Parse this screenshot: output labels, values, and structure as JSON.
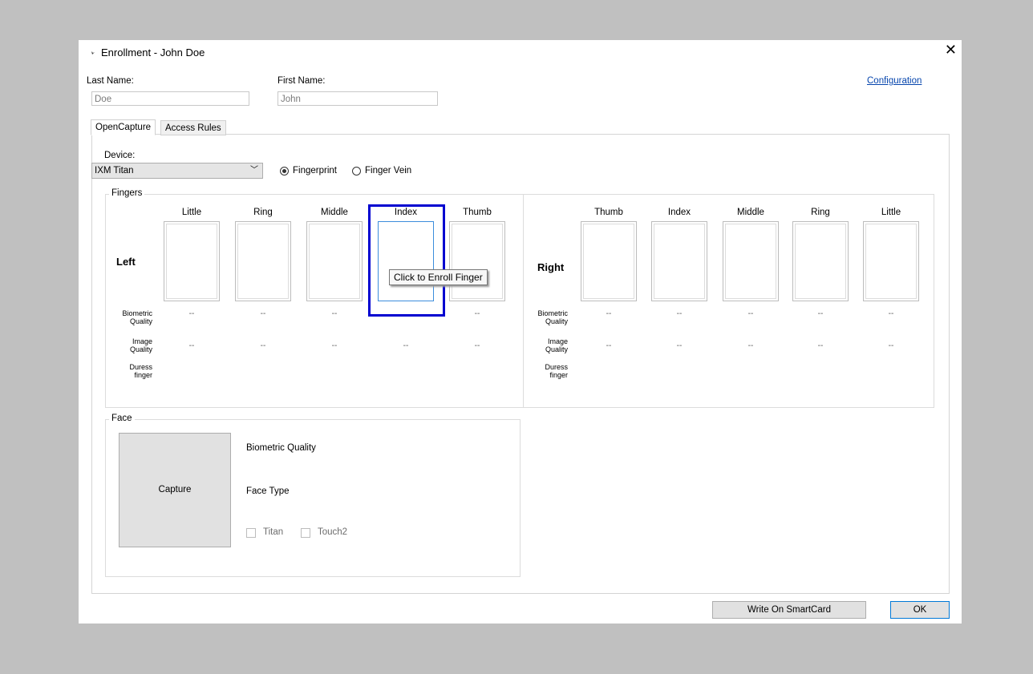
{
  "window": {
    "title": "Enrollment - John Doe",
    "close": "✕"
  },
  "fields": {
    "last_name_label": "Last Name:",
    "last_name_value": "Doe",
    "first_name_label": "First Name:",
    "first_name_value": "John"
  },
  "configuration_link": "Configuration",
  "tabs": [
    {
      "label": "OpenCapture",
      "active": true
    },
    {
      "label": "Access Rules",
      "active": false
    }
  ],
  "device": {
    "label": "Device:",
    "selected": "IXM Titan",
    "modes": [
      {
        "label": "Fingerprint",
        "checked": true
      },
      {
        "label": "Finger Vein",
        "checked": false
      }
    ]
  },
  "fingers": {
    "legend": "Fingers",
    "left_label": "Left",
    "right_label": "Right",
    "left_fingers": [
      "Little",
      "Ring",
      "Middle",
      "Index",
      "Thumb"
    ],
    "right_fingers": [
      "Thumb",
      "Index",
      "Middle",
      "Ring",
      "Little"
    ],
    "biometric_quality_label": "Biometric Quality",
    "image_quality_label": "Image Quality",
    "duress_label": "Duress finger",
    "placeholder": "--",
    "tooltip": "Click to Enroll Finger"
  },
  "face": {
    "legend": "Face",
    "capture_button": "Capture",
    "biometric_quality_label": "Biometric Quality",
    "face_type_label": "Face Type",
    "options": [
      {
        "label": "Titan",
        "checked": false
      },
      {
        "label": "Touch2",
        "checked": false
      }
    ]
  },
  "buttons": {
    "write_smartcard": "Write On SmartCard",
    "ok": "OK"
  }
}
